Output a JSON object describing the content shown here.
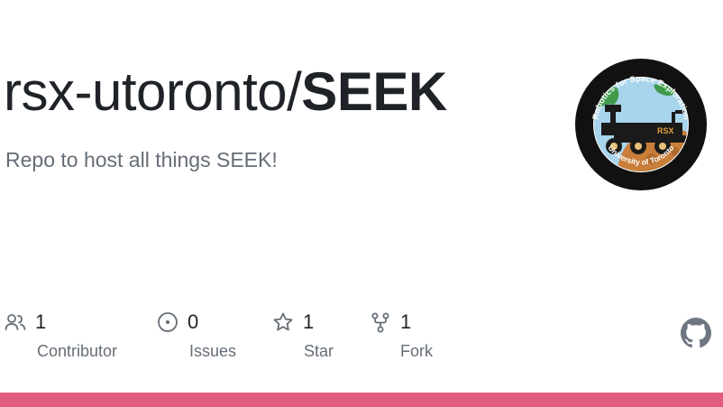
{
  "repo": {
    "owner_prefix": "rsx-utoronto/",
    "name": "SEEK",
    "description": "Repo to host all things SEEK!"
  },
  "stats": {
    "contributors": {
      "count": "1",
      "label": "Contributor",
      "icon": "people-icon"
    },
    "issues": {
      "count": "0",
      "label": "Issues",
      "icon": "issue-opened-icon"
    },
    "stars": {
      "count": "1",
      "label": "Star",
      "icon": "star-icon"
    },
    "forks": {
      "count": "1",
      "label": "Fork",
      "icon": "repo-forked-icon"
    }
  },
  "logo": {
    "top_text": "Robotics for Space Exploration",
    "bottom_text": "University of Toronto",
    "badge_text": "RSX"
  },
  "colors": {
    "language_bar": "#e05d7e",
    "text_primary": "#1f2328",
    "text_muted": "#656d76",
    "github_mark": "#6e7781"
  }
}
